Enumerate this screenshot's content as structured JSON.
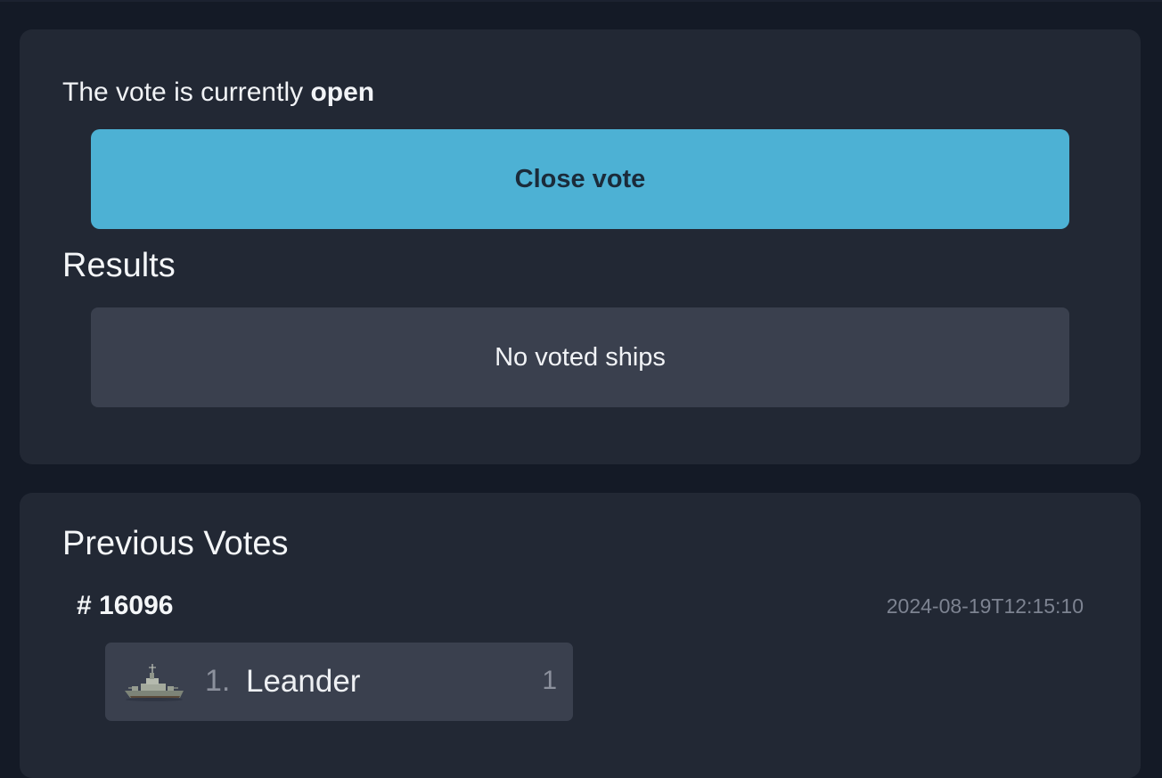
{
  "vote_status": {
    "prefix": "The vote is currently",
    "state": "open"
  },
  "close_button": {
    "label": "Close vote",
    "color": "#4db1d4"
  },
  "results": {
    "title": "Results",
    "empty_message": "No voted ships"
  },
  "previous_votes": {
    "title": "Previous Votes",
    "entries": [
      {
        "id_label": "# 16096",
        "date": "2024-08-19T12:15:10",
        "ships": [
          {
            "rank": "1.",
            "name": "Leander",
            "votes": "1",
            "icon": "warship-icon"
          }
        ]
      }
    ]
  }
}
